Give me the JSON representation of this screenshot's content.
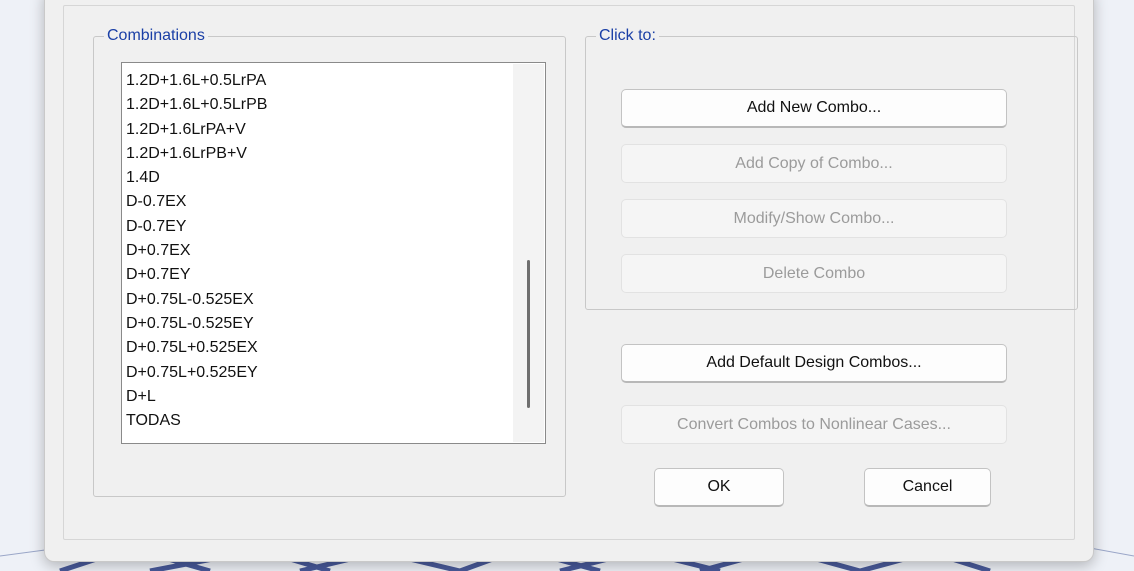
{
  "combinations": {
    "group_label": "Combinations",
    "items": [
      "1.2D+1.6L+0.5LrPA",
      "1.2D+1.6L+0.5LrPB",
      "1.2D+1.6LrPA+V",
      "1.2D+1.6LrPB+V",
      "1.4D",
      "D-0.7EX",
      "D-0.7EY",
      "D+0.7EX",
      "D+0.7EY",
      "D+0.75L-0.525EX",
      "D+0.75L-0.525EY",
      "D+0.75L+0.525EX",
      "D+0.75L+0.525EY",
      "D+L",
      "TODAS"
    ]
  },
  "click_to": {
    "group_label": "Click to:",
    "add_new_combo": "Add New Combo...",
    "add_copy_of_combo": "Add Copy of Combo...",
    "modify_show_combo": "Modify/Show Combo...",
    "delete_combo": "Delete Combo"
  },
  "actions": {
    "add_default_design_combos": "Add Default Design Combos...",
    "convert_combos_to_nonlinear_cases": "Convert Combos to Nonlinear Cases...",
    "ok": "OK",
    "cancel": "Cancel"
  },
  "states": {
    "add_copy_of_combo": "disabled",
    "modify_show_combo": "disabled",
    "delete_combo": "disabled",
    "convert_combos_to_nonlinear_cases": "disabled"
  },
  "colors": {
    "group_label": "#1a3fa6",
    "dialog_background": "#f0f0f0",
    "disabled_text": "#9b9b9b"
  }
}
